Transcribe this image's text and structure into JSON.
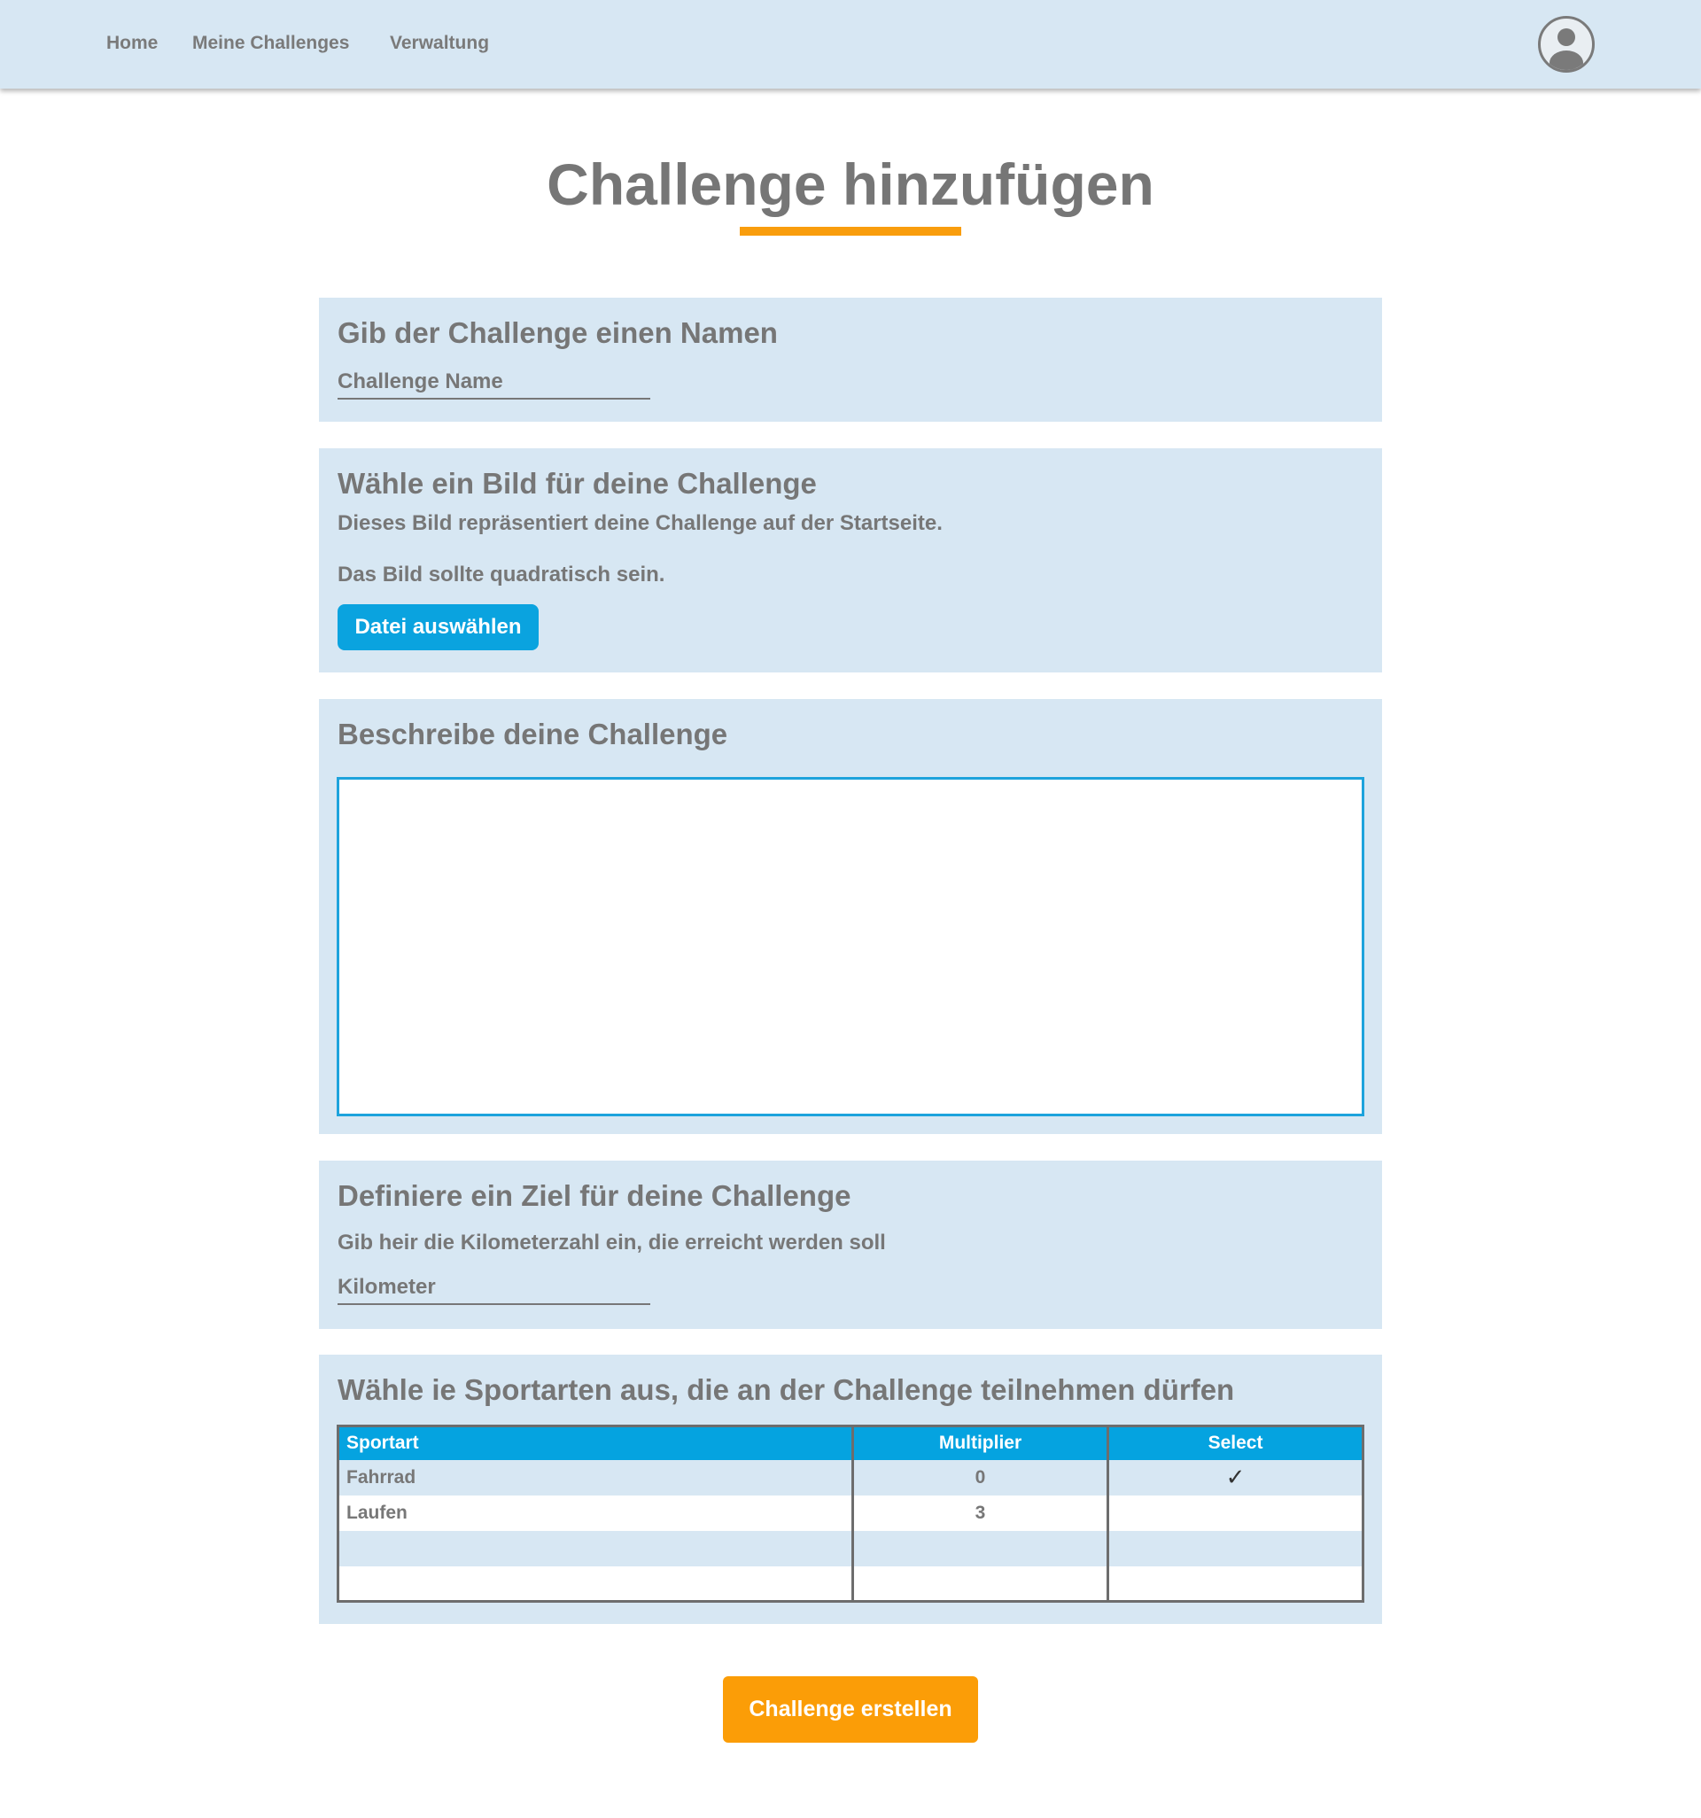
{
  "nav": {
    "items": [
      "Home",
      "Meine Challenges",
      "Verwaltung"
    ]
  },
  "page": {
    "title": "Challenge hinzufügen"
  },
  "name_section": {
    "heading": "Gib der Challenge einen Namen",
    "input_placeholder": "Challenge Name",
    "input_value": ""
  },
  "image_section": {
    "heading": "Wähle ein Bild für deine Challenge",
    "text1": "Dieses Bild repräsentiert deine Challenge auf der Startseite.",
    "text2": "Das Bild sollte quadratisch sein.",
    "button_label": "Datei auswählen"
  },
  "description_section": {
    "heading": "Beschreibe deine Challenge",
    "value": ""
  },
  "goal_section": {
    "heading": "Definiere ein Ziel für deine Challenge",
    "text": "Gib heir die Kilometerzahl ein, die erreicht werden soll",
    "input_placeholder": "Kilometer",
    "input_value": ""
  },
  "sport_section": {
    "heading": "Wähle ie Sportarten aus, die an der Challenge teilnehmen dürfen",
    "columns": [
      "Sportart",
      "Multiplier",
      "Select"
    ],
    "rows": [
      {
        "sport": "Fahrrad",
        "multiplier": "0",
        "selected": "✓"
      },
      {
        "sport": "Laufen",
        "multiplier": "3",
        "selected": ""
      },
      {
        "sport": "",
        "multiplier": "",
        "selected": ""
      },
      {
        "sport": "",
        "multiplier": "",
        "selected": ""
      }
    ]
  },
  "submit": {
    "label": "Challenge erstellen"
  },
  "icons": {
    "avatar": "user-avatar-icon",
    "check": "checkmark-icon"
  },
  "colors": {
    "nav_background": "#d7e7f3",
    "section_background": "#d7e7f3",
    "accent_orange": "#f99d0d",
    "primary_blue": "#0aa3df",
    "text_gray": "#777777"
  }
}
